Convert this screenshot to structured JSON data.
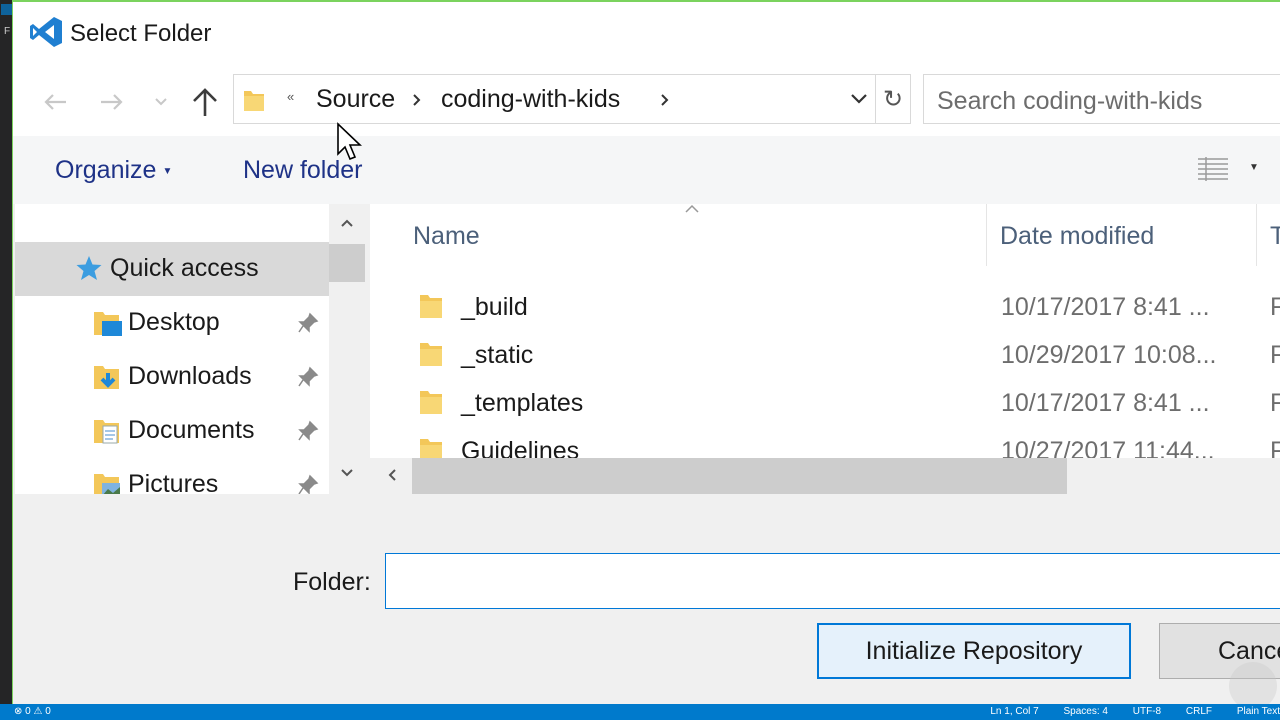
{
  "background": {
    "statusbar": {
      "left": "⊗ 0 ⚠ 0",
      "items": [
        "Ln 1, Col 7",
        "Spaces: 4",
        "UTF-8",
        "CRLF",
        "Plain Text"
      ]
    },
    "sidebar_letter": "F"
  },
  "dialog": {
    "title": "Select Folder",
    "address": {
      "overflow": "«",
      "crumbs": [
        "Source",
        "coding-with-kids"
      ]
    },
    "search_placeholder": "Search coding-with-kids",
    "toolbar": {
      "organize": "Organize",
      "new_folder": "New folder"
    },
    "nav_pane": {
      "items": [
        {
          "label": "Quick access",
          "icon": "star-icon"
        },
        {
          "label": "Desktop",
          "icon": "desktop-folder-icon",
          "pinned": true
        },
        {
          "label": "Downloads",
          "icon": "downloads-folder-icon",
          "pinned": true
        },
        {
          "label": "Documents",
          "icon": "documents-folder-icon",
          "pinned": true
        },
        {
          "label": "Pictures",
          "icon": "pictures-folder-icon",
          "pinned": true
        }
      ]
    },
    "file_list": {
      "columns": [
        "Name",
        "Date modified",
        "T"
      ],
      "rows": [
        {
          "name": "_build",
          "date": "10/17/2017 8:41 ...",
          "type": "F"
        },
        {
          "name": "_static",
          "date": "10/29/2017 10:08...",
          "type": "F"
        },
        {
          "name": "_templates",
          "date": "10/17/2017 8:41 ...",
          "type": "F"
        },
        {
          "name": "Guidelines",
          "date": "10/27/2017 11:44...",
          "type": "F"
        }
      ]
    },
    "folder_label": "Folder:",
    "folder_value": "",
    "buttons": {
      "primary": "Initialize Repository",
      "cancel": "Cance"
    }
  },
  "colors": {
    "accent": "#0078d7",
    "link_text": "#1e3287",
    "selection": "#d9d9d9",
    "statusbar": "#007acc"
  }
}
